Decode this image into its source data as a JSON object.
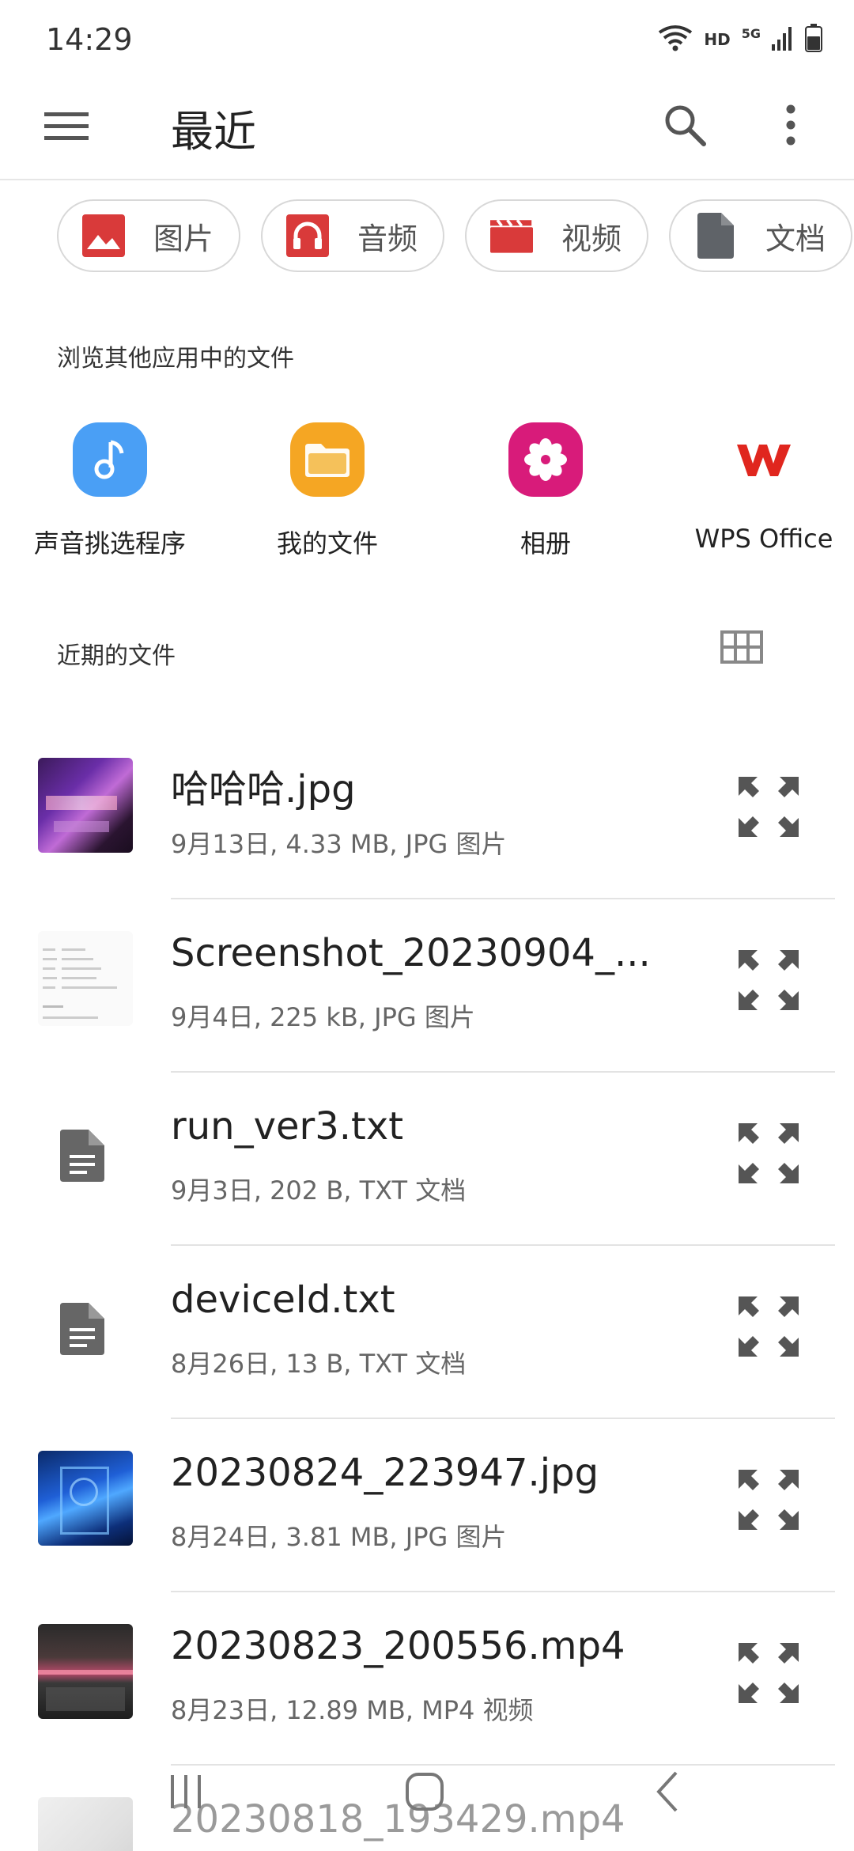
{
  "status": {
    "time": "14:29",
    "hd_label": "HD",
    "net_label": "5G"
  },
  "appbar": {
    "title": "最近",
    "menu_icon": "hamburger-menu-icon",
    "search_icon": "search-icon",
    "more_icon": "more-vertical-icon"
  },
  "chips": [
    {
      "label": "图片",
      "icon": "image-icon",
      "color": "#d93a3a"
    },
    {
      "label": "音频",
      "icon": "headphones-icon",
      "color": "#d93a3a"
    },
    {
      "label": "视频",
      "icon": "clapperboard-icon",
      "color": "#d93a3a"
    },
    {
      "label": "文档",
      "icon": "document-icon",
      "color": "#5f6368"
    }
  ],
  "browse": {
    "title": "浏览其他应用中的文件",
    "apps": [
      {
        "label": "声音挑选程序",
        "icon": "music-note-icon",
        "color": "#4a9ff5"
      },
      {
        "label": "我的文件",
        "icon": "folder-icon",
        "color": "#f5a623"
      },
      {
        "label": "相册",
        "icon": "flower-icon",
        "color": "#d81b7a"
      },
      {
        "label": "WPS Office",
        "icon": "wps-logo-icon",
        "color": "#e0261e"
      }
    ]
  },
  "recent": {
    "title": "近期的文件",
    "grid_icon": "grid-view-icon",
    "files": [
      {
        "name": "哈哈哈.jpg",
        "meta": "9月13日, 4.33 MB, JPG 图片",
        "kind": "image"
      },
      {
        "name": "Screenshot_20230904_...",
        "meta": "9月4日, 225 kB, JPG 图片",
        "kind": "screenshot"
      },
      {
        "name": "run_ver3.txt",
        "meta": "9月3日, 202 B, TXT 文档",
        "kind": "text"
      },
      {
        "name": "deviceId.txt",
        "meta": "8月26日, 13 B, TXT 文档",
        "kind": "text"
      },
      {
        "name": "20230824_223947.jpg",
        "meta": "8月24日, 3.81 MB, JPG 图片",
        "kind": "image"
      },
      {
        "name": "20230823_200556.mp4",
        "meta": "8月23日, 12.89 MB, MP4 视频",
        "kind": "video"
      },
      {
        "name": "20230818_193429.mp4",
        "meta": "",
        "kind": "video"
      }
    ]
  },
  "navbar": {
    "recents_icon": "recent-apps-icon",
    "home_icon": "home-icon",
    "back_icon": "back-icon"
  },
  "colors": {
    "accent_red": "#d93a3a",
    "divider": "#e3e3e3",
    "text_secondary": "#666666"
  }
}
